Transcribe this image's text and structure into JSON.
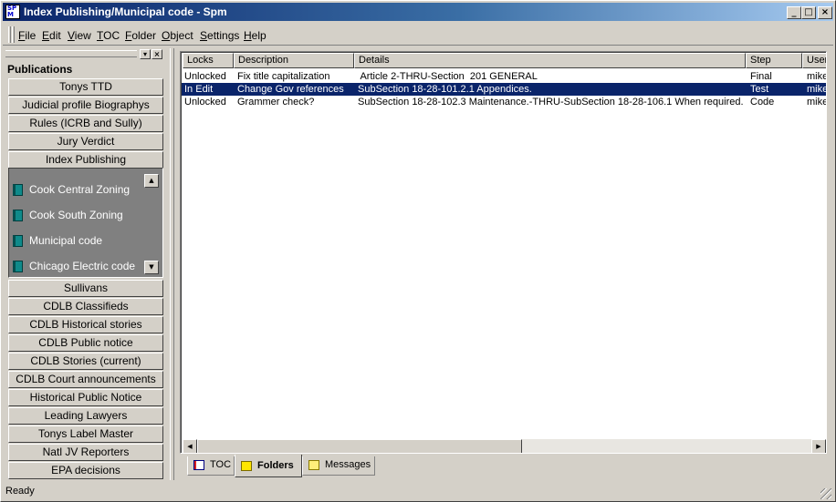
{
  "window": {
    "title": "Index Publishing/Municipal code - Spm",
    "icon_text_top": "SP",
    "icon_text_bottom": "M",
    "minimize": "_",
    "maximize": "□",
    "close": "×"
  },
  "menu": [
    {
      "label": "File",
      "key": "F",
      "rest": "ile"
    },
    {
      "label": "Edit",
      "key": "E",
      "rest": "dit"
    },
    {
      "label": "View",
      "key": "V",
      "rest": "iew"
    },
    {
      "label": "TOC",
      "key": "T",
      "rest": "OC"
    },
    {
      "label": "Folder",
      "key": "F",
      "rest": "older"
    },
    {
      "label": "Object",
      "key": "O",
      "rest": "bject"
    },
    {
      "label": "Settings",
      "key": "S",
      "rest": "ettings"
    },
    {
      "label": "Help",
      "key": "H",
      "rest": "elp"
    }
  ],
  "sidebar": {
    "title": "Publications",
    "pin": "▾",
    "close": "×",
    "top_items": [
      "Tonys TTD",
      "Judicial profile Biographys",
      "Rules (ICRB and Sully)",
      "Jury Verdict",
      "Index Publishing"
    ],
    "books": [
      "Cook Central Zoning",
      "Cook South Zoning",
      "Municipal code",
      "Chicago Electric code"
    ],
    "scroll_up": "▲",
    "scroll_down": "▼",
    "bottom_items": [
      "Sullivans",
      "CDLB Classifieds",
      "CDLB Historical stories",
      "CDLB Public notice",
      "CDLB Stories (current)",
      "CDLB Court announcements",
      "Historical Public Notice",
      "Leading Lawyers",
      "Tonys Label Master",
      "Natl JV Reporters",
      "EPA decisions"
    ]
  },
  "table": {
    "columns": [
      "Locks",
      "Description",
      "Details",
      "Step",
      "User"
    ],
    "rows": [
      {
        "lock": "Unlocked",
        "description": "Fix title capitalization",
        "details": " Article 2-THRU-Section  201 GENERAL",
        "step": "Final",
        "user": "mike",
        "selected": false
      },
      {
        "lock": "In Edit",
        "description": "Change Gov references",
        "details": "SubSection 18-28-101.2.1 Appendices.",
        "step": "Test",
        "user": "mike",
        "selected": true
      },
      {
        "lock": "Unlocked",
        "description": "Grammer check?",
        "details": "SubSection 18-28-102.3 Maintenance.-THRU-SubSection 18-28-106.1 When required.",
        "step": "Code",
        "user": "mike",
        "selected": false
      }
    ]
  },
  "scroll": {
    "left": "◀",
    "right": "▶"
  },
  "tabs": [
    {
      "label": "TOC",
      "active": false
    },
    {
      "label": "Folders",
      "active": true
    },
    {
      "label": "Messages",
      "active": false
    }
  ],
  "status": {
    "text": "Ready"
  },
  "colors": {
    "titlebar_start": "#0a246a",
    "titlebar_end": "#a6caf0",
    "selection": "#0a246a",
    "panel": "#808080",
    "book_icon": "#0f8a8a"
  }
}
